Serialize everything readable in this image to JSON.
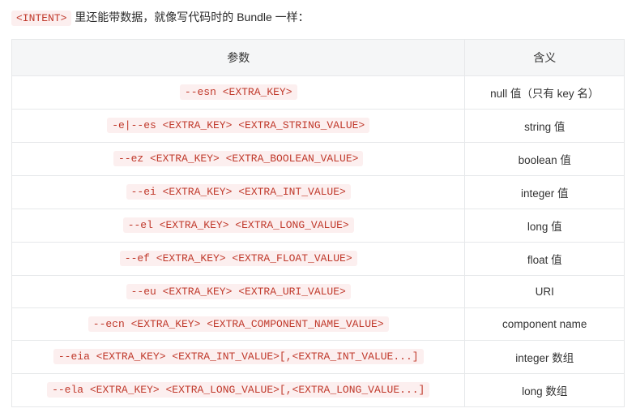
{
  "intro": {
    "code_tag": "<INTENT>",
    "suffix_text": " 里还能带数据，就像写代码时的 Bundle 一样："
  },
  "table": {
    "headers": {
      "param": "参数",
      "meaning": "含义"
    },
    "rows": [
      {
        "param": "--esn <EXTRA_KEY>",
        "meaning": "null 值（只有 key 名）"
      },
      {
        "param": "-e|--es <EXTRA_KEY> <EXTRA_STRING_VALUE>",
        "meaning": "string 值"
      },
      {
        "param": "--ez <EXTRA_KEY> <EXTRA_BOOLEAN_VALUE>",
        "meaning": "boolean 值"
      },
      {
        "param": "--ei <EXTRA_KEY> <EXTRA_INT_VALUE>",
        "meaning": "integer 值"
      },
      {
        "param": "--el <EXTRA_KEY> <EXTRA_LONG_VALUE>",
        "meaning": "long 值"
      },
      {
        "param": "--ef <EXTRA_KEY> <EXTRA_FLOAT_VALUE>",
        "meaning": "float 值"
      },
      {
        "param": "--eu <EXTRA_KEY> <EXTRA_URI_VALUE>",
        "meaning": "URI"
      },
      {
        "param": "--ecn <EXTRA_KEY> <EXTRA_COMPONENT_NAME_VALUE>",
        "meaning": "component name"
      },
      {
        "param": "--eia <EXTRA_KEY> <EXTRA_INT_VALUE>[,<EXTRA_INT_VALUE...]",
        "meaning": "integer 数组"
      },
      {
        "param": "--ela <EXTRA_KEY> <EXTRA_LONG_VALUE>[,<EXTRA_LONG_VALUE...]",
        "meaning": "long 数组"
      }
    ]
  }
}
